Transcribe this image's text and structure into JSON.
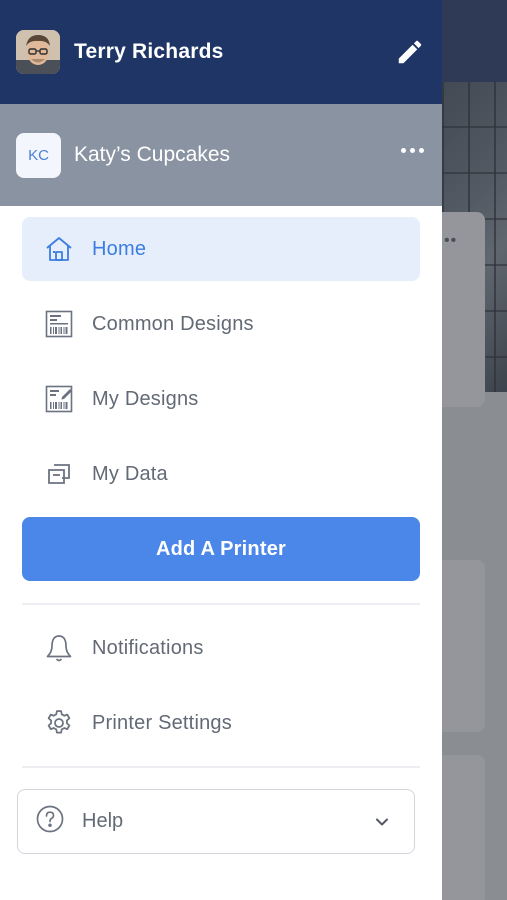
{
  "user": {
    "name": "Terry Richards"
  },
  "organization": {
    "initials": "KC",
    "name": "Katy’s Cupcakes"
  },
  "nav": {
    "items": [
      {
        "label": "Home",
        "icon": "home-icon",
        "active": true
      },
      {
        "label": "Common Designs",
        "icon": "barcode-label-icon",
        "active": false
      },
      {
        "label": "My Designs",
        "icon": "edit-label-icon",
        "active": false
      },
      {
        "label": "My Data",
        "icon": "data-icon",
        "active": false
      }
    ],
    "add_printer_label": "Add A Printer"
  },
  "secondary_nav": {
    "items": [
      {
        "label": "Notifications",
        "icon": "bell-icon"
      },
      {
        "label": "Printer Settings",
        "icon": "gear-icon"
      }
    ]
  },
  "help": {
    "label": "Help",
    "icon": "question-icon"
  },
  "colors": {
    "header_bg": "#1e3566",
    "org_bar_bg": "#8a93a2",
    "accent": "#4a87e8",
    "active_item_bg": "#e6eefc",
    "text_muted": "#636a75"
  }
}
